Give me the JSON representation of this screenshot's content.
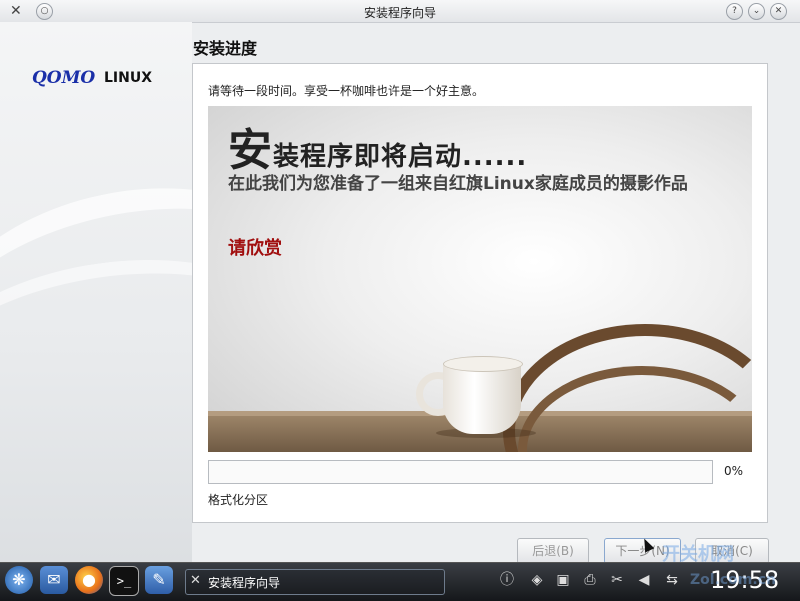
{
  "window": {
    "title": "安装程序向导"
  },
  "brand": {
    "qomo": "QOMO",
    "linux": "LINUX"
  },
  "page": {
    "title": "安装进度",
    "wait_text": "请等待一段时间。享受一杯咖啡也许是一个好主意。"
  },
  "slide": {
    "headline_big": "安",
    "headline_rest": "装程序即将启动......",
    "subtitle": "在此我们为您准备了一组来自红旗Linux家庭成员的摄影作品",
    "enjoy": "请欣赏"
  },
  "progress": {
    "value": 0.0,
    "label": "0%",
    "status": "格式化分区"
  },
  "buttons": {
    "back": "后退(B)",
    "next": "下一步(N)",
    "cancel": "取消(C)"
  },
  "taskbar": {
    "task_label": "安装程序向导",
    "clock": "19:58",
    "icons": [
      "start-icon",
      "mail-icon",
      "firefox-icon",
      "terminal-icon",
      "edit-icon"
    ],
    "tray_icons": [
      "info-icon",
      "network-icon",
      "display-icon",
      "printer-icon",
      "clipboard-icon",
      "volume-icon",
      "usb-icon"
    ]
  },
  "watermark": {
    "line1": "开关机网",
    "line2": "Zol.com.cn"
  },
  "colors": {
    "accent": "#5d8fd0",
    "brand_blue": "#1a2fa8",
    "enjoy_red": "#a10f0f"
  }
}
